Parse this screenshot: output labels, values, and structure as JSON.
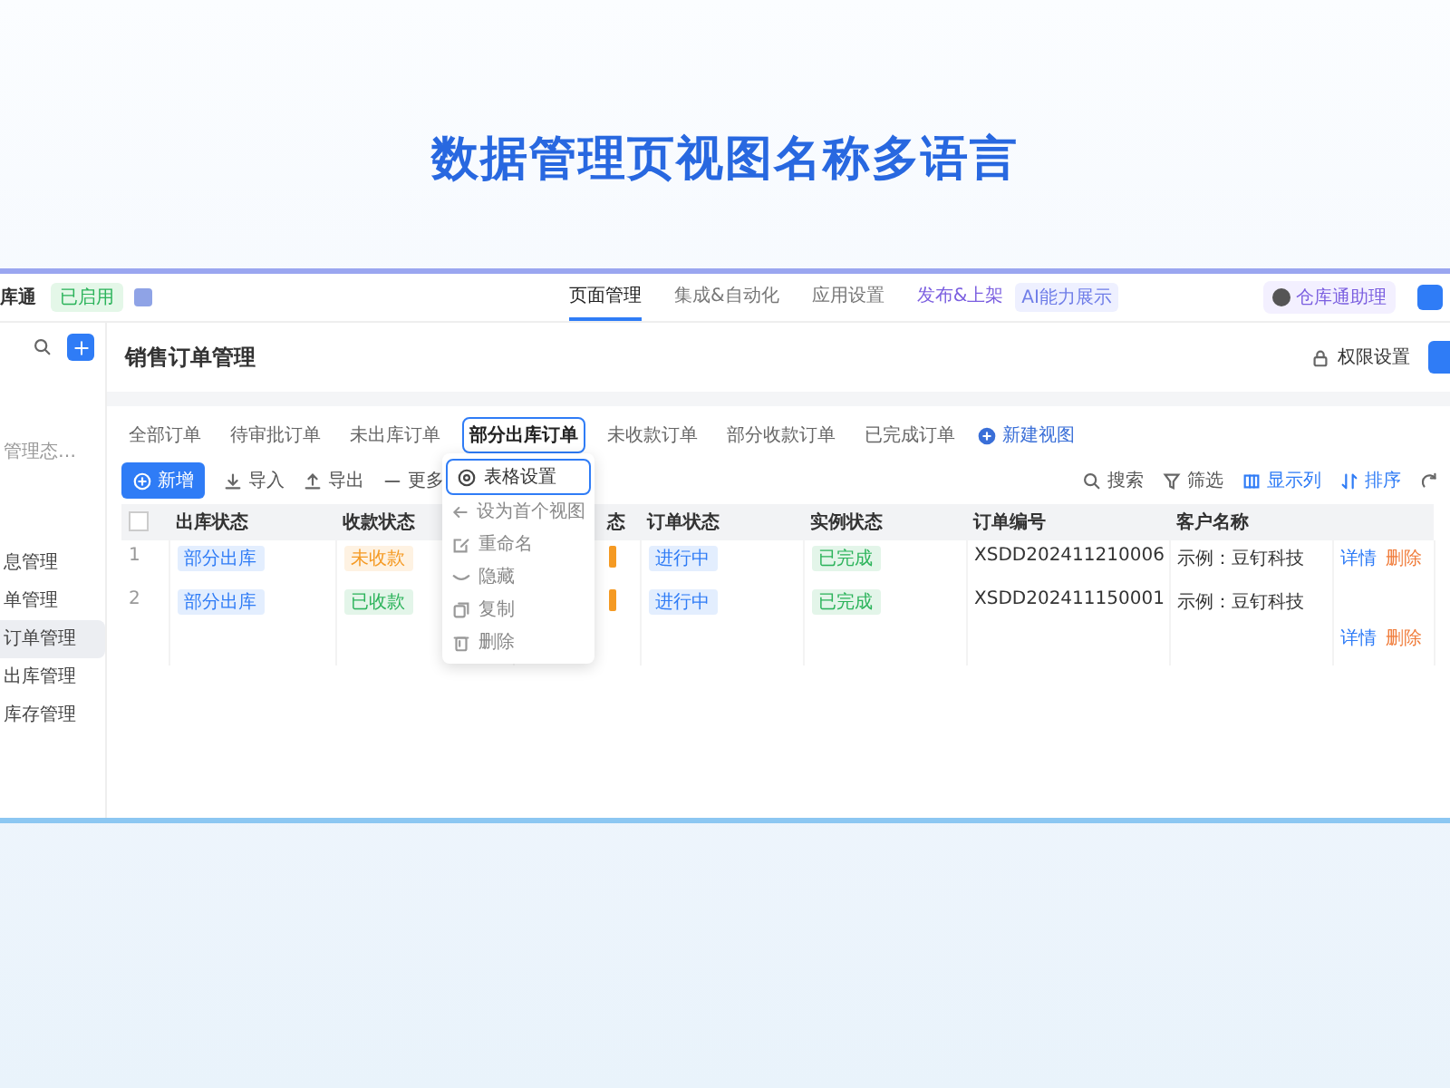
{
  "headline": "数据管理页视图名称多语言",
  "topbar": {
    "app_name": "库通",
    "status_badge": "已启用",
    "nav": [
      {
        "label": "页面管理",
        "selected": true
      },
      {
        "label": "集成&自动化",
        "selected": false
      },
      {
        "label": "应用设置",
        "selected": false
      },
      {
        "label": "发布&上架",
        "selected": false
      }
    ],
    "ai_badge": "AI能力展示",
    "user": "仓库通助理"
  },
  "sidebar": {
    "items": [
      {
        "label": "管理态…",
        "kind": "group"
      },
      {
        "label": "息管理",
        "kind": "page",
        "selected": false
      },
      {
        "label": "单管理",
        "kind": "page",
        "selected": false
      },
      {
        "label": "订单管理",
        "kind": "page",
        "selected": true
      },
      {
        "label": "出库管理",
        "kind": "page",
        "selected": false
      },
      {
        "label": "库存管理",
        "kind": "page",
        "selected": false
      }
    ]
  },
  "page_title": "销售订单管理",
  "permission_button": "权限设置",
  "view_tabs": [
    {
      "label": "全部订单",
      "selected": false
    },
    {
      "label": "待审批订单",
      "selected": false
    },
    {
      "label": "未出库订单",
      "selected": false
    },
    {
      "label": "部分出库订单",
      "selected": true
    },
    {
      "label": "未收款订单",
      "selected": false
    },
    {
      "label": "部分收款订单",
      "selected": false
    },
    {
      "label": "已完成订单",
      "selected": false
    }
  ],
  "new_view": "新建视图",
  "toolbar": {
    "left": [
      {
        "label": "新增",
        "kind": "primary"
      },
      {
        "label": "导入",
        "kind": "import"
      },
      {
        "label": "导出",
        "kind": "export"
      },
      {
        "label": "更多",
        "kind": "more"
      }
    ],
    "right": [
      {
        "label": "搜索",
        "kind": "search",
        "highlighted": false
      },
      {
        "label": "筛选",
        "kind": "filter",
        "highlighted": false
      },
      {
        "label": "显示列",
        "kind": "columns",
        "highlighted": true
      },
      {
        "label": "排序",
        "kind": "sort",
        "highlighted": true
      }
    ]
  },
  "table": {
    "select_all_checked": false,
    "columns": [
      "出库状态",
      "收款状态",
      "态",
      "订单状态",
      "实例状态",
      "订单编号",
      "客户名称"
    ],
    "rows": [
      {
        "index": "1",
        "cells": [
          {
            "kind": "tag",
            "text": "部分出库",
            "color": "#2f7cf6"
          },
          {
            "kind": "tag",
            "text": "未收款",
            "color": "#f59a23"
          },
          {
            "kind": "sliver",
            "color": "#f59a23"
          },
          {
            "kind": "tag",
            "text": "进行中",
            "color": "#2f7cf6"
          },
          {
            "kind": "tag",
            "text": "已完成",
            "color": "#2bb35a"
          },
          {
            "kind": "text",
            "text": "XSDD202411210006"
          },
          {
            "kind": "text",
            "text": "示例：豆钉科技"
          }
        ],
        "actions": [
          "详情",
          "删除"
        ]
      },
      {
        "index": "2",
        "cells": [
          {
            "kind": "tag",
            "text": "部分出库",
            "color": "#2f7cf6"
          },
          {
            "kind": "tag",
            "text": "已收款",
            "color": "#2bb35a"
          },
          {
            "kind": "sliver",
            "color": "#f59a23"
          },
          {
            "kind": "tag",
            "text": "进行中",
            "color": "#2f7cf6"
          },
          {
            "kind": "tag",
            "text": "已完成",
            "color": "#2bb35a"
          },
          {
            "kind": "text",
            "text": "XSDD202411150001"
          },
          {
            "kind": "text",
            "text": "示例：豆钉科技"
          }
        ],
        "actions": [
          "详情",
          "删除"
        ]
      }
    ]
  },
  "view_menu": {
    "items": [
      {
        "label": "表格设置",
        "selected": true
      },
      {
        "label": "设为首个视图",
        "selected": false
      },
      {
        "label": "重命名",
        "selected": false
      },
      {
        "label": "隐藏",
        "selected": false
      },
      {
        "label": "复制",
        "selected": false
      },
      {
        "label": "删除",
        "selected": false
      }
    ]
  }
}
